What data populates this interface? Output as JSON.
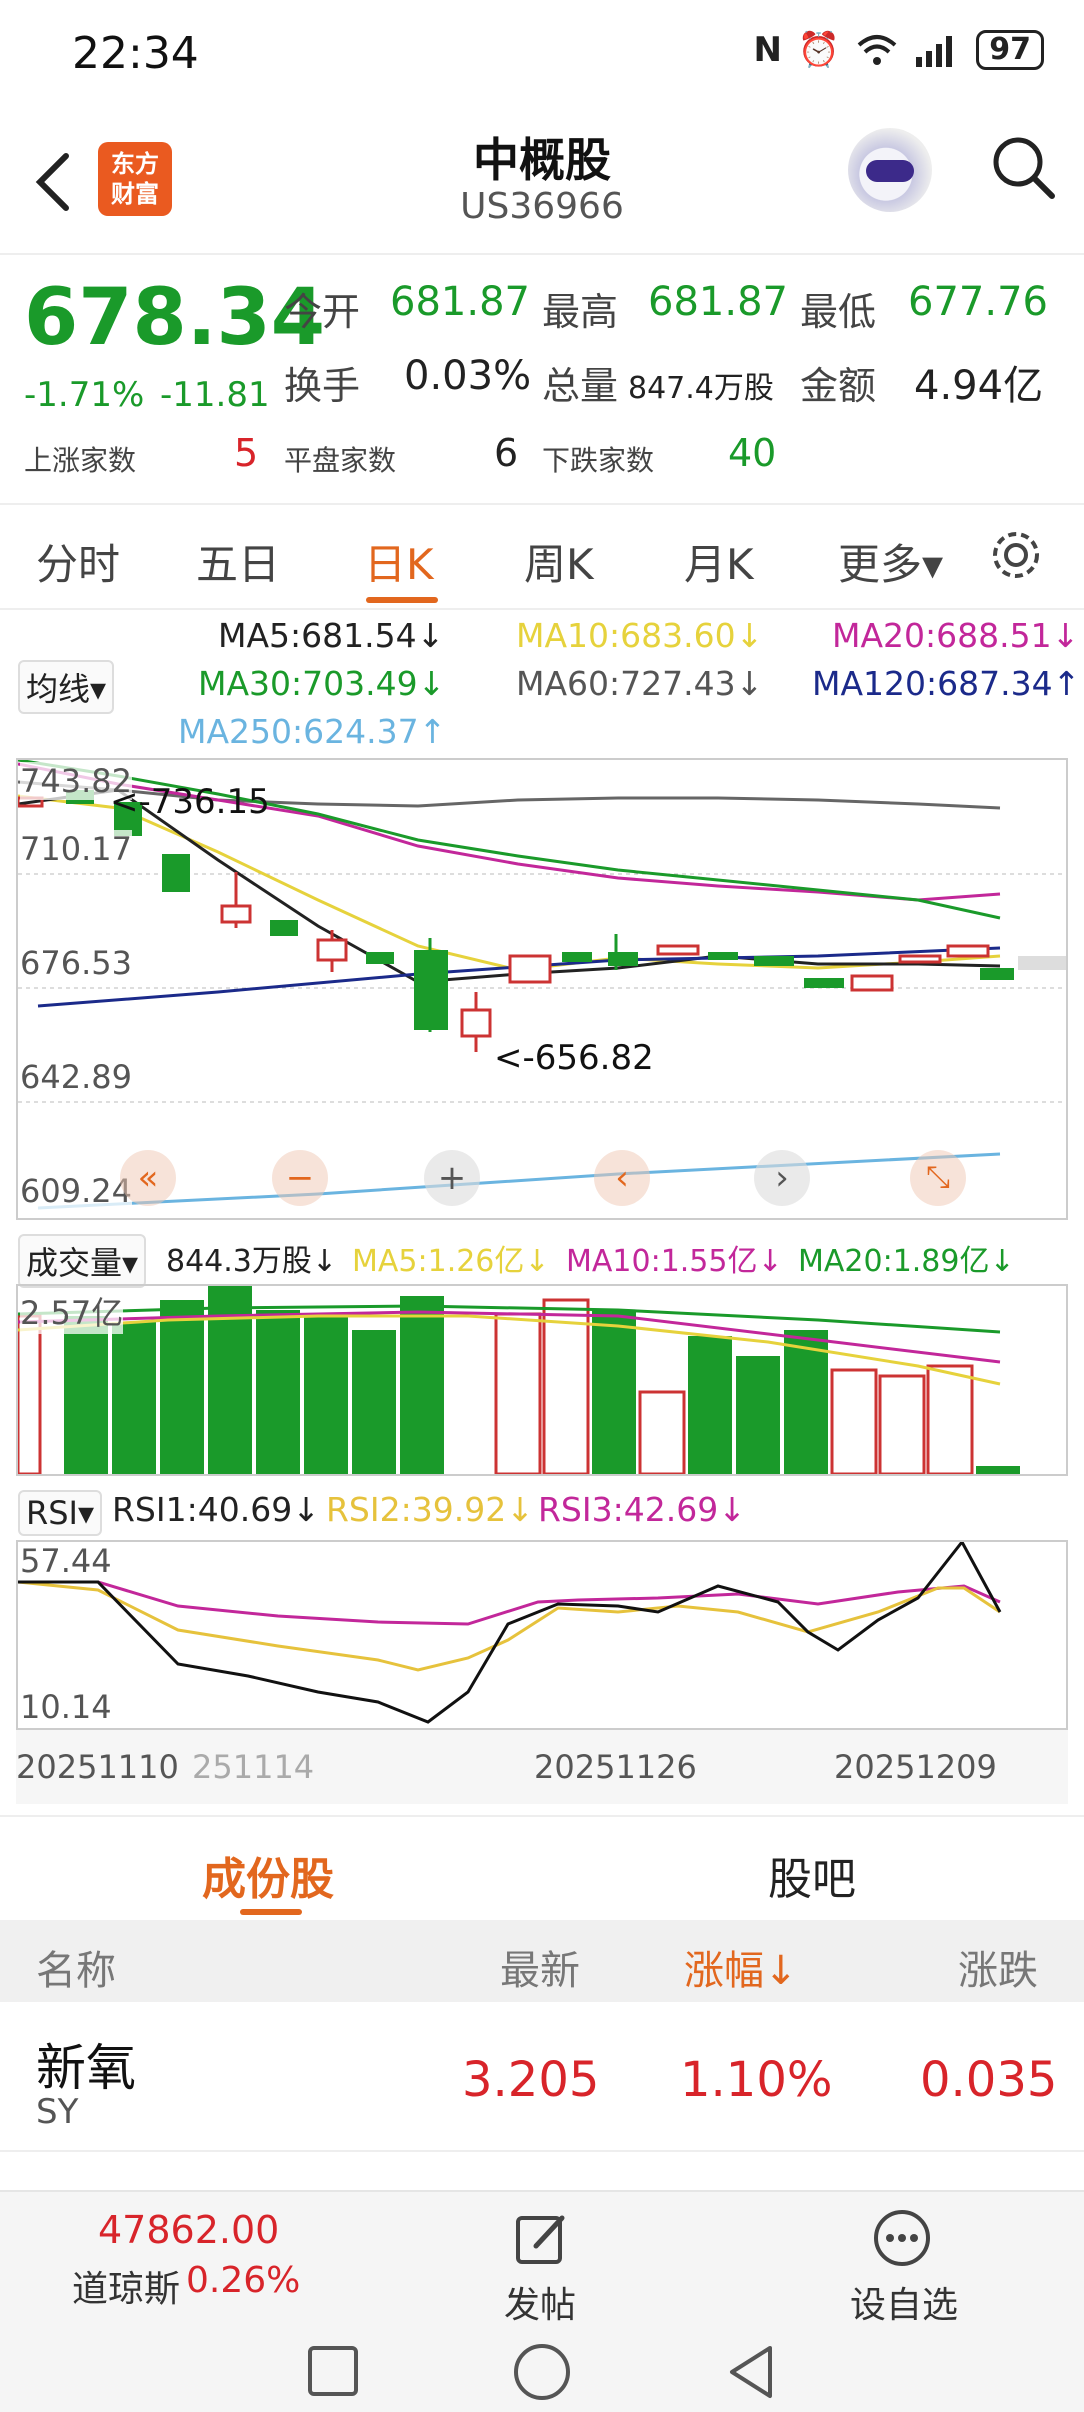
{
  "status": {
    "time": "22:34",
    "battery": "97"
  },
  "header": {
    "logo_line1": "东方",
    "logo_line2": "财富",
    "title": "中概股",
    "code": "US36966"
  },
  "quote": {
    "price": "678.34",
    "change_pct": "-1.71%",
    "change": "-11.81",
    "open_label": "今开",
    "open": "681.87",
    "high_label": "最高",
    "high": "681.87",
    "low_label": "最低",
    "low": "677.76",
    "turnover_label": "换手",
    "turnover": "0.03%",
    "volume_label": "总量",
    "volume": "847.4万股",
    "amount_label": "金额",
    "amount": "4.94亿",
    "up_label": "上涨家数",
    "up": "5",
    "flat_label": "平盘家数",
    "flat": "6",
    "down_label": "下跌家数",
    "down": "40"
  },
  "tabs": [
    "分时",
    "五日",
    "日K",
    "周K",
    "月K",
    "更多▾"
  ],
  "ma": {
    "selector": "均线▾",
    "ma5": "MA5:681.54↓",
    "ma10": "MA10:683.60↓",
    "ma20": "MA20:688.51↓",
    "ma30": "MA30:703.49↓",
    "ma60": "MA60:727.43↓",
    "ma120": "MA120:687.34↑",
    "ma250": "MA250:624.37↑"
  },
  "chart": {
    "y_labels": [
      "743.82",
      "710.17",
      "676.53",
      "642.89",
      "609.24"
    ],
    "max_note": "<-736.15",
    "min_note": "<-656.82",
    "dates": [
      "20251110",
      "251114",
      "20251126",
      "20251209"
    ]
  },
  "volume": {
    "selector": "成交量▾",
    "value": "844.3万股↓",
    "ma5": "MA5:1.26亿↓",
    "ma10": "MA10:1.55亿↓",
    "ma20": "MA20:1.89亿↓",
    "top_label": "2.57亿"
  },
  "rsi": {
    "selector": "RSI▾",
    "rsi1": "RSI1:40.69↓",
    "rsi2": "RSI2:39.92↓",
    "rsi3": "RSI3:42.69↓",
    "top_label": "57.44",
    "bottom_label": "10.14"
  },
  "colors": {
    "up": "#d8242a",
    "down": "#1a9a2a",
    "accent": "#e2671e"
  },
  "bottom_tabs": [
    "成份股",
    "股吧"
  ],
  "list": {
    "headers": {
      "name": "名称",
      "latest": "最新",
      "change_pct": "涨幅↓",
      "change": "涨跌"
    },
    "rows": [
      {
        "name": "新氧",
        "code": "SY",
        "latest": "3.205",
        "change_pct": "1.10%",
        "change": "0.035"
      }
    ]
  },
  "footer": {
    "index_value": "47862.00",
    "index_name": "道琼斯",
    "index_change": "0.26%",
    "post_label": "发帖",
    "watch_label": "设自选"
  }
}
